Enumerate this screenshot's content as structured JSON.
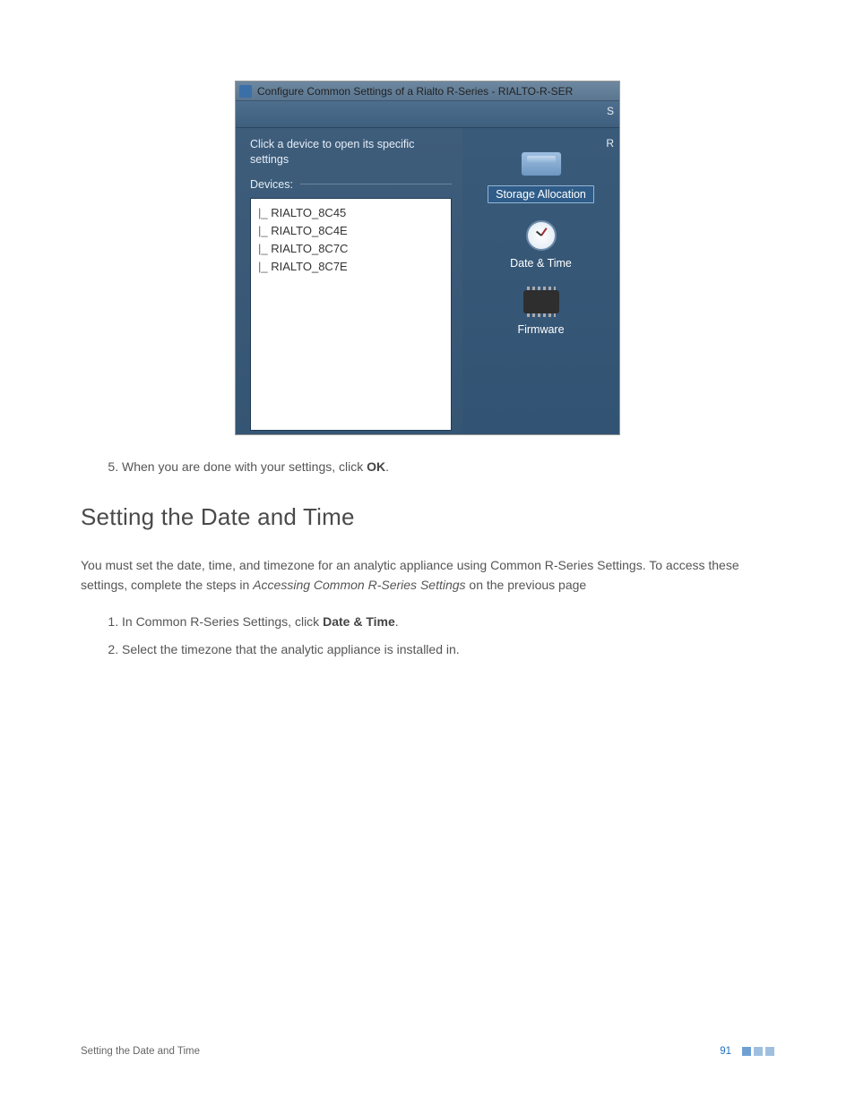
{
  "screenshot": {
    "window_title": "Configure Common Settings of a Rialto R-Series - RIALTO-R-SER",
    "ribbon_right_hint": "S",
    "right_badge_hint": "R",
    "hint_text": "Click a device to open its specific settings",
    "devices_label": "Devices:",
    "devices": [
      "RIALTO_8C45",
      "RIALTO_8C4E",
      "RIALTO_8C7C",
      "RIALTO_8C7E"
    ],
    "options": {
      "storage": "Storage Allocation",
      "datetime": "Date & Time",
      "firmware": "Firmware"
    }
  },
  "step5": {
    "prefix": "When you are done with your settings, click ",
    "bold": "OK",
    "suffix": "."
  },
  "heading": "Setting the Date and Time",
  "intro": {
    "part1": "You must set the date, time, and timezone for an analytic appliance using Common R-Series Settings. To access these settings, complete the steps in ",
    "italic": "Accessing Common R-Series Settings",
    "part2": " on the previous page"
  },
  "steps_b": {
    "s1_prefix": "In Common R-Series Settings, click ",
    "s1_bold": "Date & Time",
    "s1_suffix": ".",
    "s2": "Select the timezone that the analytic appliance is installed in."
  },
  "footer": {
    "title": "Setting the Date and Time",
    "page": "91"
  }
}
